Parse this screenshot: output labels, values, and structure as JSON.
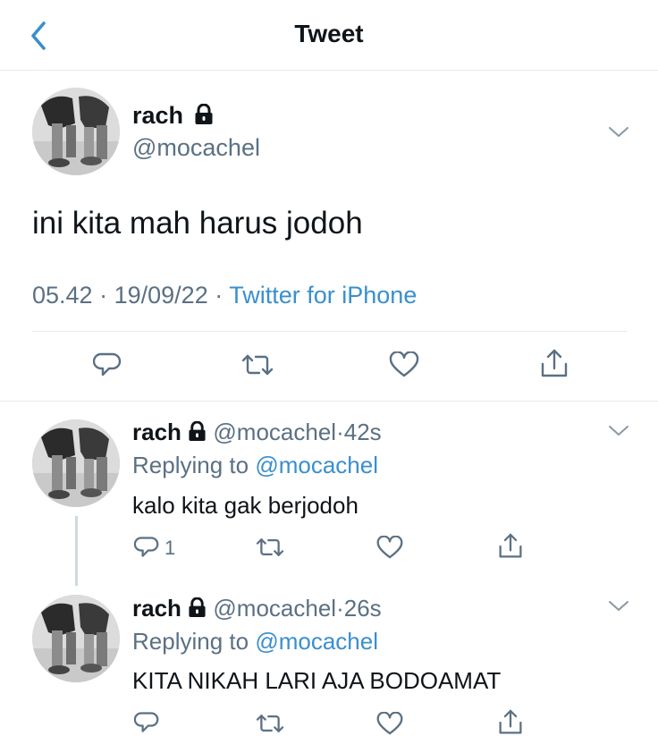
{
  "header": {
    "title": "Tweet"
  },
  "main_tweet": {
    "display_name": "rach",
    "handle": "@mocachel",
    "text": "ini kita mah harus jodoh",
    "time": "05.42",
    "date": "19/09/22",
    "source": "Twitter for iPhone",
    "separator": "·"
  },
  "replies": [
    {
      "display_name": "rach",
      "handle": "@mocachel",
      "age": "42s",
      "replying_label": "Replying to",
      "replying_handle": "@mocachel",
      "text": "kalo kita gak berjodoh",
      "reply_count": "1"
    },
    {
      "display_name": "rach",
      "handle": "@mocachel",
      "age": "26s",
      "replying_label": "Replying to",
      "replying_handle": "@mocachel",
      "text": "KITA NIKAH LARI AJA BODOAMAT",
      "reply_count": ""
    }
  ],
  "colors": {
    "accent": "#3a8fcd",
    "secondary_text": "#5b7083",
    "divider": "#e6e8ea"
  },
  "icons": [
    "back-icon",
    "lock-icon",
    "chevron-down-icon",
    "reply-icon",
    "retweet-icon",
    "like-icon",
    "share-icon"
  ]
}
